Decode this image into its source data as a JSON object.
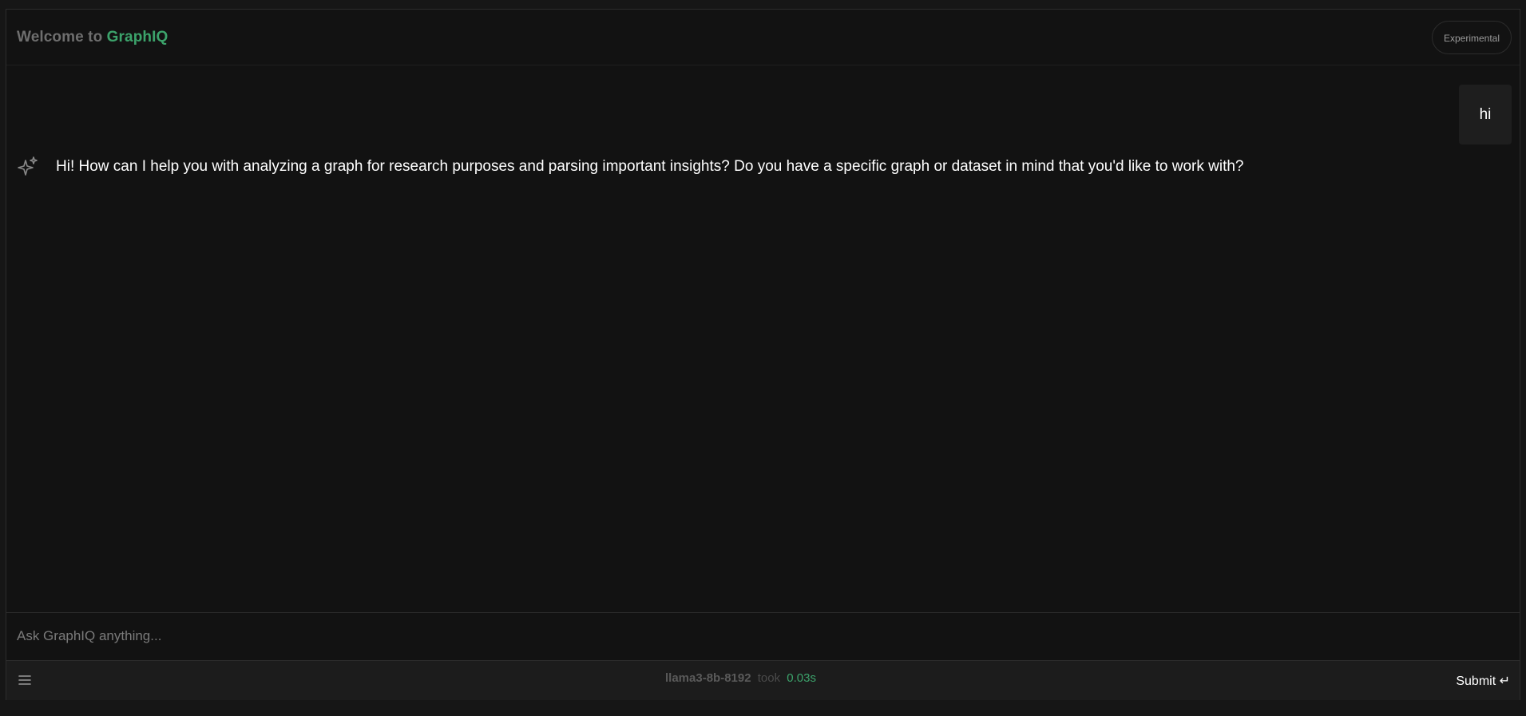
{
  "header": {
    "title_prefix": "Welcome to",
    "brand": "GraphIQ",
    "badge": "Experimental"
  },
  "messages": {
    "user": "hi",
    "assistant": "Hi! How can I help you with analyzing a graph for research purposes and parsing important insights? Do you have a specific graph or dataset in mind that you'd like to work with?"
  },
  "input": {
    "placeholder": "Ask GraphIQ anything..."
  },
  "footer": {
    "model": "llama3-8b-8192",
    "took_label": "took",
    "duration": "0.03s",
    "submit_label": "Submit",
    "submit_icon": "↵"
  },
  "icons": {
    "assistant": "sparkle-icon",
    "menu": "menu-icon",
    "submit": "return-icon"
  },
  "colors": {
    "accent": "#3ca36b",
    "background": "#121212"
  }
}
